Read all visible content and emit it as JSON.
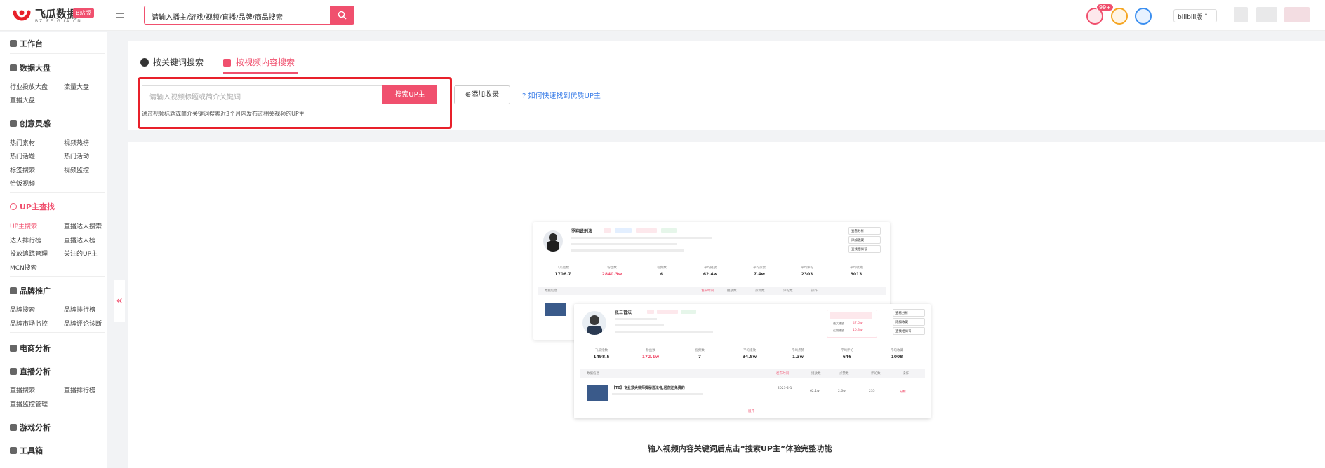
{
  "brand": {
    "name": "飞瓜数据",
    "sub": "BZ.FEIGUA.CN",
    "badge": "B站版"
  },
  "header": {
    "search_placeholder": "请输入播主/游戏/视频/直播/品牌/商品搜索",
    "notif_count": "99+",
    "platform": "bilibili版"
  },
  "sidebar": {
    "sections": [
      {
        "title": "工作台",
        "items": []
      },
      {
        "title": "数据大盘",
        "items": [
          "行业投放大盘",
          "流量大盘",
          "直播大盘"
        ]
      },
      {
        "title": "创意灵感",
        "items": [
          "热门素材",
          "视频热榜",
          "热门话题",
          "热门活动",
          "标签搜索",
          "视频监控",
          "恰饭视频"
        ]
      },
      {
        "title": "UP主查找",
        "items": [
          "UP主搜索",
          "直播达人搜索",
          "达人排行榜",
          "直播达人榜",
          "投放追踪管理",
          "关注的UP主",
          "MCN搜索"
        ]
      },
      {
        "title": "品牌推广",
        "items": [
          "品牌搜索",
          "品牌排行榜",
          "品牌市场监控",
          "品牌评论诊断"
        ]
      },
      {
        "title": "电商分析",
        "items": []
      },
      {
        "title": "直播分析",
        "items": [
          "直播搜索",
          "直播排行榜",
          "直播监控管理"
        ]
      },
      {
        "title": "游戏分析",
        "items": []
      },
      {
        "title": "工具箱",
        "items": []
      }
    ]
  },
  "tabs": [
    "按关键词搜索",
    "按视频内容搜索"
  ],
  "video_search": {
    "placeholder": "请输入视频标题或简介关键词",
    "button": "搜索UP主",
    "hint": "通过视频标题或简介关键词搜索近3个月内发布过相关视频的UP主",
    "add_button": "添加收录",
    "how_link": "如何快速找到优质UP主"
  },
  "preview": {
    "card1": {
      "name": "罗翔说刑法",
      "stats": [
        {
          "label": "飞瓜指数",
          "value": "1706.7"
        },
        {
          "label": "粉丝数",
          "value": "2840.3w"
        },
        {
          "label": "视频数",
          "value": "6"
        },
        {
          "label": "平均播放",
          "value": "62.4w"
        },
        {
          "label": "平均点赞",
          "value": "7.4w"
        },
        {
          "label": "平均评论",
          "value": "2303"
        },
        {
          "label": "平均收藏",
          "value": "8013"
        }
      ],
      "buttons": [
        "查看分析",
        "添加收藏",
        "查找相似号"
      ],
      "table_headers": [
        "数据信息",
        "发布时间",
        "播放数",
        "点赞数",
        "评论数",
        "操作"
      ]
    },
    "card2": {
      "name": "张三普法",
      "stats": [
        {
          "label": "飞瓜指数",
          "value": "1498.5"
        },
        {
          "label": "粉丝数",
          "value": "172.1w"
        },
        {
          "label": "视频数",
          "value": "7"
        },
        {
          "label": "平均播放",
          "value": "34.8w"
        },
        {
          "label": "平均点赞",
          "value": "1.3w"
        },
        {
          "label": "平均评论",
          "value": "646"
        },
        {
          "label": "平均收藏",
          "value": "1008"
        }
      ],
      "buttons": [
        "查看分析",
        "添加收藏",
        "查找相似号"
      ],
      "side_stats": [
        {
          "label": "最大播放",
          "value": "47.5w"
        },
        {
          "label": "近期播放",
          "value": "10.3w"
        }
      ],
      "table_headers": [
        "数据信息",
        "发布时间",
        "播放数",
        "点赞数",
        "评论数",
        "操作"
      ],
      "row": {
        "title": "【T0】专业顶尖律师揭秘违法者,居然还免费的",
        "date": "2023-2-1",
        "views": "62.1w",
        "likes": "2.6w",
        "comments": "235",
        "action": "分析"
      },
      "expand": "展开"
    }
  },
  "caption": "输入视频内容关键词后点击“搜索UP主”体验完整功能"
}
